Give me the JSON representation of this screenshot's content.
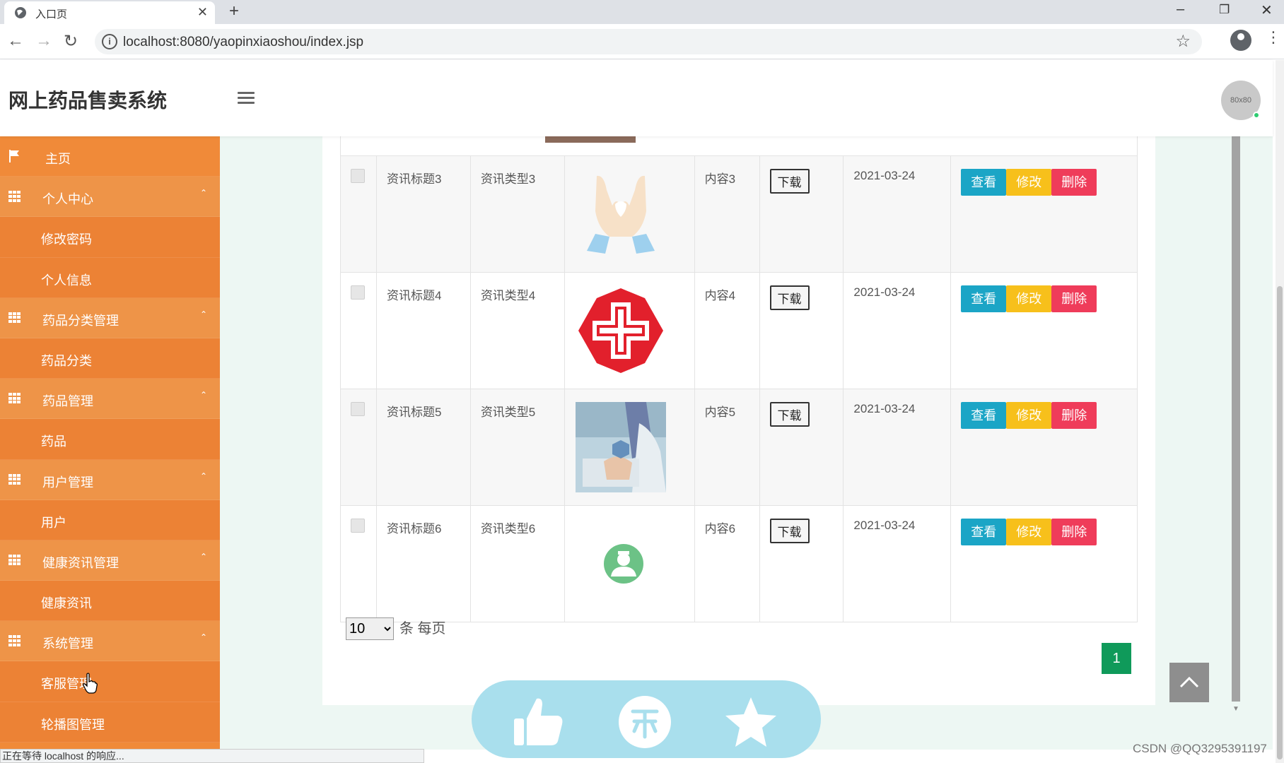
{
  "browser": {
    "tab_title": "入口页",
    "url": "localhost:8080/yaopinxiaoshou/index.jsp",
    "status_text": "正在等待 localhost 的响应..."
  },
  "header": {
    "app_title": "网上药品售卖系统",
    "avatar_text": "80x80"
  },
  "sidebar": {
    "items": [
      {
        "label": "主页",
        "kind": "home"
      },
      {
        "label": "个人中心",
        "kind": "group"
      },
      {
        "label": "修改密码",
        "kind": "sub"
      },
      {
        "label": "个人信息",
        "kind": "sub"
      },
      {
        "label": "药品分类管理",
        "kind": "group"
      },
      {
        "label": "药品分类",
        "kind": "sub"
      },
      {
        "label": "药品管理",
        "kind": "group"
      },
      {
        "label": "药品",
        "kind": "sub"
      },
      {
        "label": "用户管理",
        "kind": "group"
      },
      {
        "label": "用户",
        "kind": "sub"
      },
      {
        "label": "健康资讯管理",
        "kind": "group"
      },
      {
        "label": "健康资讯",
        "kind": "sub"
      },
      {
        "label": "系统管理",
        "kind": "group"
      },
      {
        "label": "客服管理",
        "kind": "sub"
      },
      {
        "label": "轮播图管理",
        "kind": "sub"
      }
    ]
  },
  "table": {
    "download_label": "下载",
    "view_label": "查看",
    "edit_label": "修改",
    "delete_label": "删除",
    "rows": [
      {
        "title": "资讯标题3",
        "type": "资讯类型3",
        "image": "hands-heart-image",
        "content": "内容3",
        "date": "2021-03-24"
      },
      {
        "title": "资讯标题4",
        "type": "资讯类型4",
        "image": "red-cross-image",
        "content": "内容4",
        "date": "2021-03-24"
      },
      {
        "title": "资讯标题5",
        "type": "资讯类型5",
        "image": "doctor-photo-image",
        "content": "内容5",
        "date": "2021-03-24"
      },
      {
        "title": "资讯标题6",
        "type": "资讯类型6",
        "image": "doctor-badge-image",
        "content": "内容6",
        "date": "2021-03-24"
      }
    ]
  },
  "pagination": {
    "page_size": "10",
    "per_page_text": "条 每页",
    "current_page": "1"
  },
  "watermark": "CSDN @QQ3295391197",
  "colors": {
    "sidebar": "#f08a39",
    "view": "#1ba5c6",
    "edit": "#f7c01b",
    "delete": "#ef3c5a",
    "page": "#0f9a5a"
  }
}
